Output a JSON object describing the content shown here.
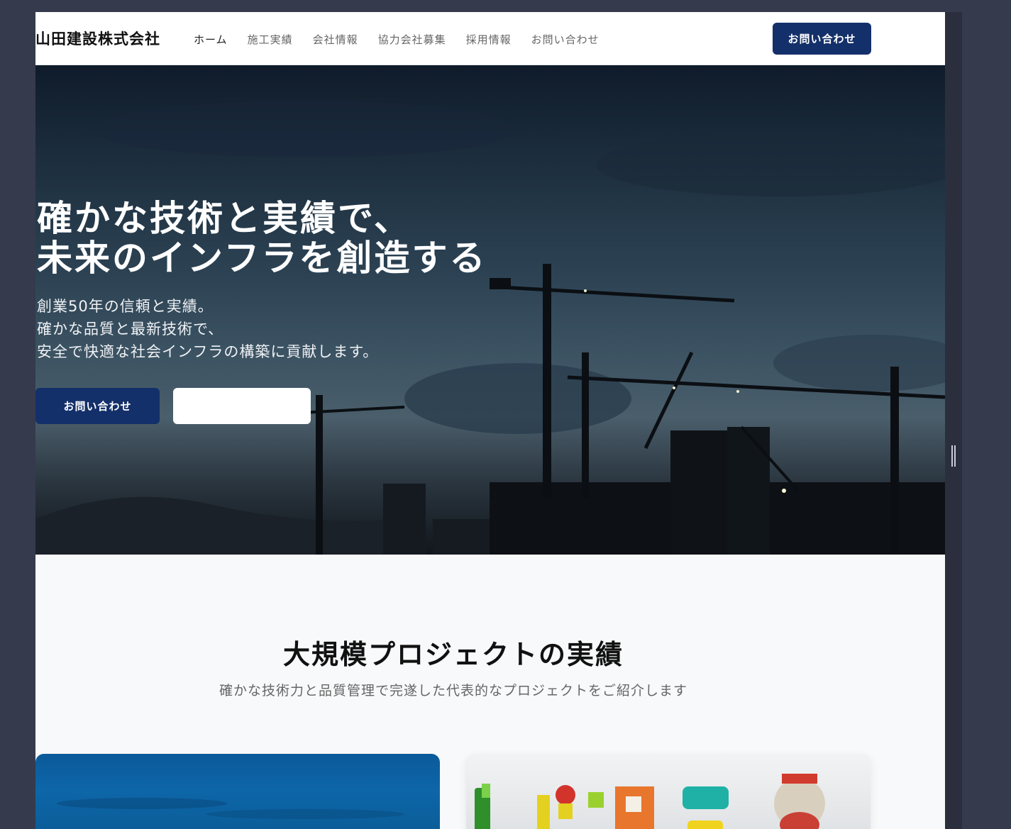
{
  "header": {
    "logo": "山田建設株式会社",
    "nav": [
      "ホーム",
      "施工実績",
      "会社情報",
      "協力会社募集",
      "採用情報",
      "お問い合わせ"
    ],
    "cta": "お問い合わせ"
  },
  "hero": {
    "title_line1": "確かな技術と実績で、",
    "title_line2": "未来のインフラを創造する",
    "sub_line1": "創業50年の信頼と実績。",
    "sub_line2": "確かな品質と最新技術で、",
    "sub_line3": "安全で快適な社会インフラの構築に貢献します。",
    "primary_button": "お問い合わせ",
    "secondary_button": ""
  },
  "projects": {
    "title": "大規模プロジェクトの実績",
    "subtitle": "確かな技術力と品質管理で完遂した代表的なプロジェクトをご紹介します"
  },
  "colors": {
    "brand": "#14306a",
    "background": "#f8f9fa",
    "chrome": "#353a4d"
  }
}
